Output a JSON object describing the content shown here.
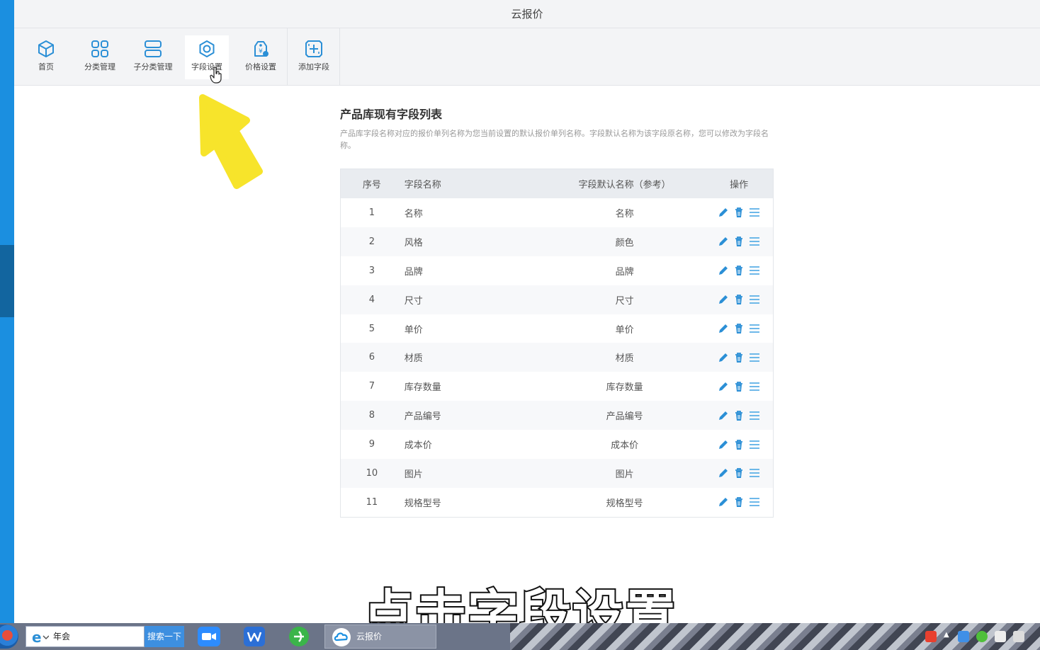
{
  "window": {
    "title": "云报价"
  },
  "toolbar": {
    "items": [
      {
        "label": "首页",
        "icon": "cube-icon"
      },
      {
        "label": "分类管理",
        "icon": "grid-icon"
      },
      {
        "label": "子分类管理",
        "icon": "rows-icon"
      },
      {
        "label": "字段设置",
        "icon": "gear-icon",
        "active": true
      },
      {
        "label": "价格设置",
        "icon": "price-tag-icon"
      },
      {
        "label": "添加字段",
        "icon": "add-box-icon"
      }
    ]
  },
  "page": {
    "title": "产品库现有字段列表",
    "description": "产品库字段名称对应的报价单列名称为您当前设置的默认报价单列名称。字段默认名称为该字段原名称，您可以修改为字段名称。"
  },
  "table": {
    "headers": [
      "序号",
      "字段名称",
      "字段默认名称（参考）",
      "操作"
    ],
    "rows": [
      {
        "no": "1",
        "name": "名称",
        "default": "名称"
      },
      {
        "no": "2",
        "name": "风格",
        "default": "颜色"
      },
      {
        "no": "3",
        "name": "品牌",
        "default": "品牌"
      },
      {
        "no": "4",
        "name": "尺寸",
        "default": "尺寸"
      },
      {
        "no": "5",
        "name": "单价",
        "default": "单价"
      },
      {
        "no": "6",
        "name": "材质",
        "default": "材质"
      },
      {
        "no": "7",
        "name": "库存数量",
        "default": "库存数量"
      },
      {
        "no": "8",
        "name": "产品编号",
        "default": "产品编号"
      },
      {
        "no": "9",
        "name": "成本价",
        "default": "成本价"
      },
      {
        "no": "10",
        "name": "图片",
        "default": "图片"
      },
      {
        "no": "11",
        "name": "规格型号",
        "default": "规格型号"
      }
    ],
    "actions": [
      "edit-icon",
      "delete-icon",
      "sort-handle-icon"
    ]
  },
  "caption": "点击字段设置",
  "taskbar": {
    "search_value": "年会",
    "search_button": "搜索一下",
    "active_task": "云报价"
  },
  "colors": {
    "accent": "#1b8fe0",
    "icon_blue": "#2b8fd6",
    "arrow_yellow": "#f7e21a"
  }
}
